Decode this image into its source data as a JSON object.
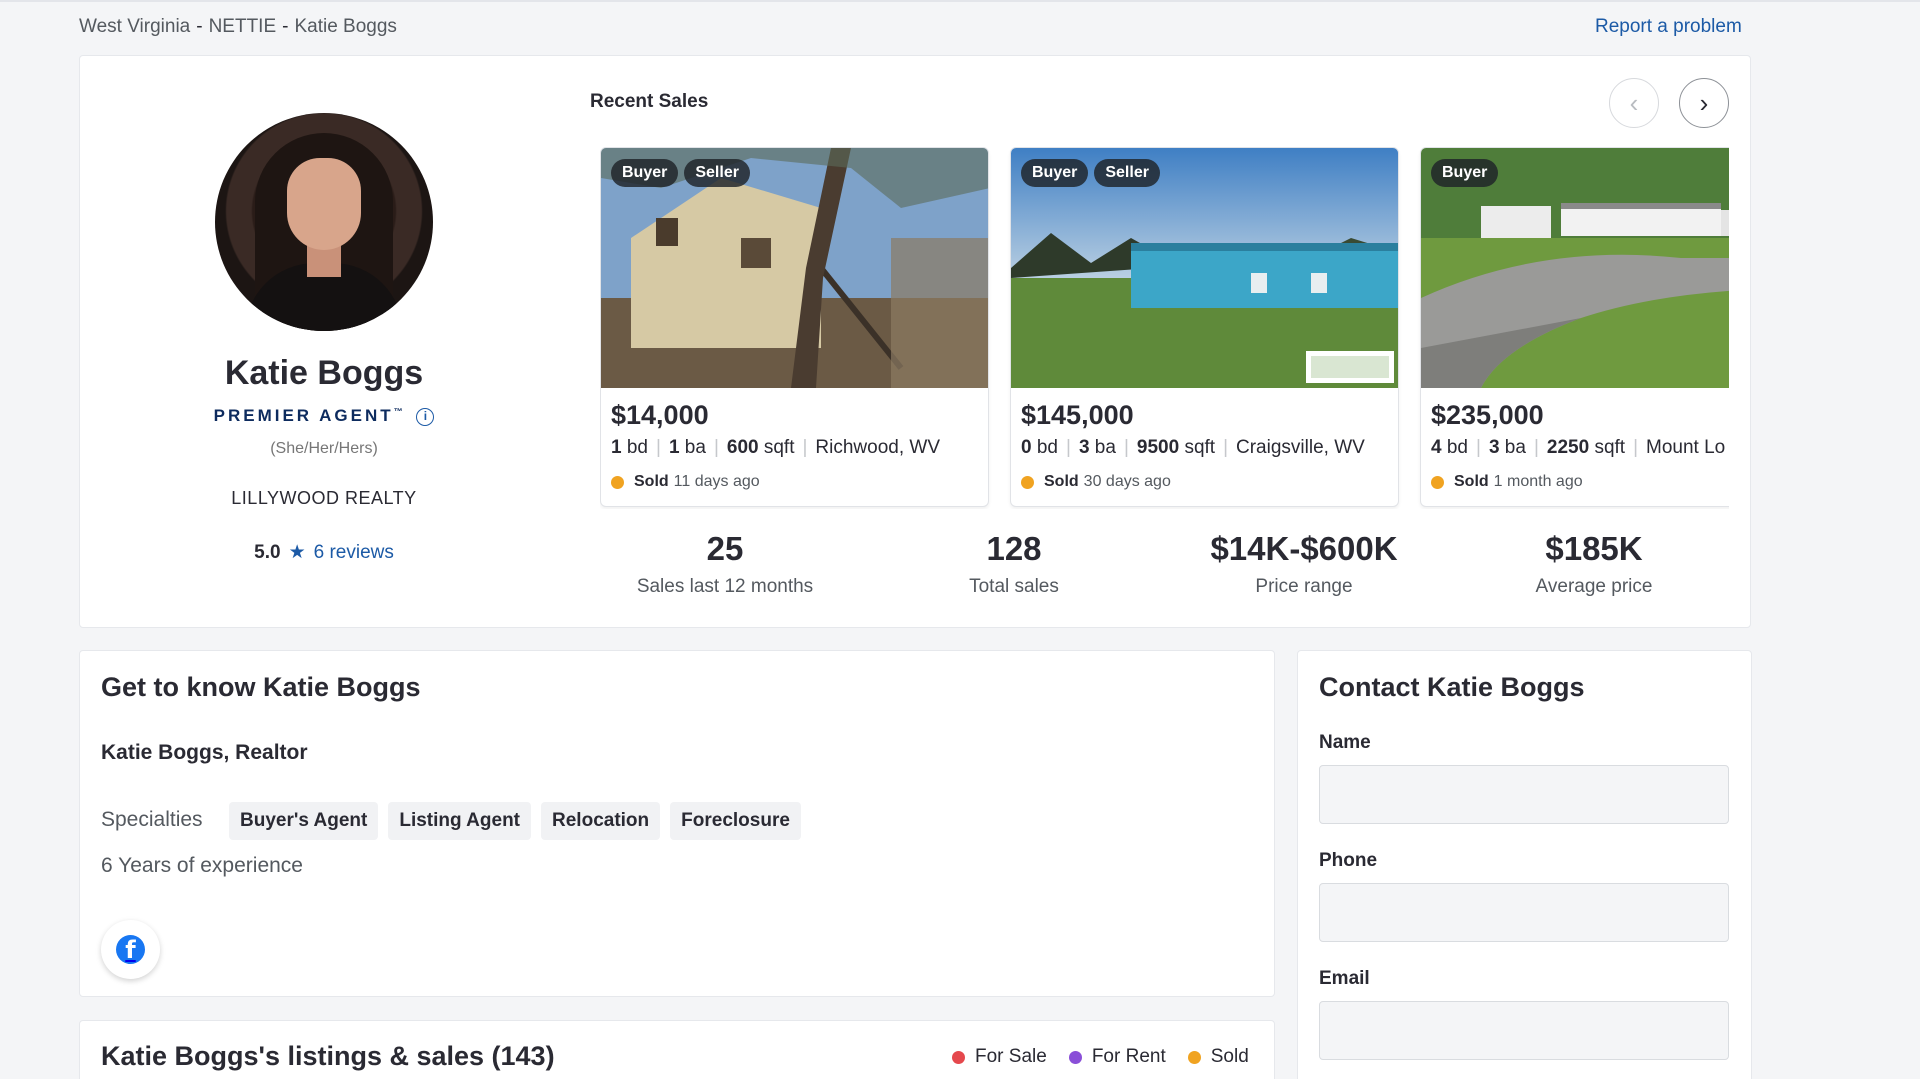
{
  "breadcrumb": {
    "state": "West Virginia",
    "city": "NETTIE",
    "agent": "Katie Boggs",
    "separator": "-"
  },
  "report_link": "Report a problem",
  "profile": {
    "name": "Katie Boggs",
    "badge": "PREMIER AGENT",
    "badge_info": "i",
    "pronouns": "(She/Her/Hers)",
    "brokerage": "LILLYWOOD REALTY",
    "rating": "5.0",
    "reviews": "6 reviews"
  },
  "recent_sales": {
    "title": "Recent Sales",
    "prev_icon": "chevron-left-icon",
    "next_icon": "chevron-right-icon",
    "items": [
      {
        "badges": [
          "Buyer",
          "Seller"
        ],
        "price": "$14,000",
        "beds": "1",
        "beds_unit": "bd",
        "baths": "1",
        "baths_unit": "ba",
        "sqft": "600",
        "sqft_unit": "sqft",
        "location": "Richwood, WV",
        "status": "Sold",
        "when": "11 days ago"
      },
      {
        "badges": [
          "Buyer",
          "Seller"
        ],
        "price": "$145,000",
        "beds": "0",
        "beds_unit": "bd",
        "baths": "3",
        "baths_unit": "ba",
        "sqft": "9500",
        "sqft_unit": "sqft",
        "location": "Craigsville, WV",
        "status": "Sold",
        "when": "30 days ago"
      },
      {
        "badges": [
          "Buyer"
        ],
        "price": "$235,000",
        "beds": "4",
        "beds_unit": "bd",
        "baths": "3",
        "baths_unit": "ba",
        "sqft": "2250",
        "sqft_unit": "sqft",
        "location": "Mount Lo",
        "status": "Sold",
        "when": "1 month ago"
      }
    ]
  },
  "stats": [
    {
      "value": "25",
      "label": "Sales last 12 months"
    },
    {
      "value": "128",
      "label": "Total sales"
    },
    {
      "value": "$14K-$600K",
      "label": "Price range"
    },
    {
      "value": "$185K",
      "label": "Average price"
    }
  ],
  "about": {
    "title": "Get to know Katie Boggs",
    "subtitle": "Katie Boggs, Realtor",
    "specialties_label": "Specialties",
    "specialties": [
      "Buyer's Agent",
      "Listing Agent",
      "Relocation",
      "Foreclosure"
    ],
    "experience": "6 Years of experience",
    "social_icon": "facebook-icon",
    "facebook_glyph": "f"
  },
  "listings": {
    "title": "Katie Boggs's listings & sales (143)",
    "legend": [
      {
        "label": "For Sale",
        "color": "#e5484d"
      },
      {
        "label": "For Rent",
        "color": "#8a4fd8"
      },
      {
        "label": "Sold",
        "color": "#f0a321"
      }
    ]
  },
  "contact": {
    "title": "Contact Katie Boggs",
    "fields": [
      {
        "label": "Name",
        "value": "",
        "placeholder": ""
      },
      {
        "label": "Phone",
        "value": "",
        "placeholder": ""
      },
      {
        "label": "Email",
        "value": "",
        "placeholder": ""
      }
    ]
  },
  "colors": {
    "accent": "#1c5aa6",
    "sold": "#f0a321",
    "premier": "#0d2b5e"
  }
}
